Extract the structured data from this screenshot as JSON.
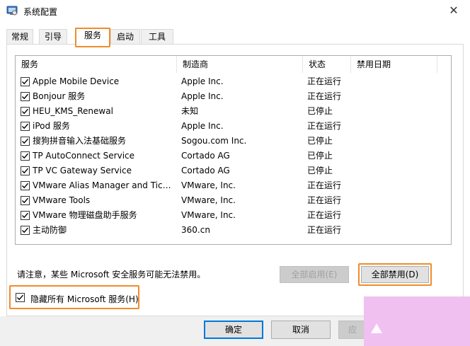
{
  "window": {
    "title": "系统配置",
    "close_glyph": "✕"
  },
  "tabs": [
    {
      "label": "常规"
    },
    {
      "label": "引导"
    },
    {
      "label": "服务"
    },
    {
      "label": "启动"
    },
    {
      "label": "工具"
    }
  ],
  "active_tab": "服务",
  "table": {
    "columns": [
      "服务",
      "制造商",
      "状态",
      "禁用日期"
    ],
    "rows": [
      {
        "service": "Apple Mobile Device",
        "maker": "Apple Inc.",
        "status": "正在运行",
        "date": "",
        "checked": true
      },
      {
        "service": "Bonjour 服务",
        "maker": "Apple Inc.",
        "status": "正在运行",
        "date": "",
        "checked": true
      },
      {
        "service": "HEU_KMS_Renewal",
        "maker": "未知",
        "status": "已停止",
        "date": "",
        "checked": true
      },
      {
        "service": "iPod 服务",
        "maker": "Apple Inc.",
        "status": "正在运行",
        "date": "",
        "checked": true
      },
      {
        "service": "搜狗拼音输入法基础服务",
        "maker": "Sogou.com Inc.",
        "status": "已停止",
        "date": "",
        "checked": true
      },
      {
        "service": "TP AutoConnect Service",
        "maker": "Cortado AG",
        "status": "已停止",
        "date": "",
        "checked": true
      },
      {
        "service": "TP VC Gateway Service",
        "maker": "Cortado AG",
        "status": "已停止",
        "date": "",
        "checked": true
      },
      {
        "service": "VMware Alias Manager and Tick…",
        "maker": "VMware, Inc.",
        "status": "正在运行",
        "date": "",
        "checked": true
      },
      {
        "service": "VMware Tools",
        "maker": "VMware, Inc.",
        "status": "正在运行",
        "date": "",
        "checked": true
      },
      {
        "service": "VMware 物理磁盘助手服务",
        "maker": "VMware, Inc.",
        "status": "正在运行",
        "date": "",
        "checked": true
      },
      {
        "service": "主动防御",
        "maker": "360.cn",
        "status": "正在运行",
        "date": "",
        "checked": true
      }
    ]
  },
  "notice": "请注意，某些 Microsoft 安全服务可能无法禁用。",
  "buttons": {
    "enable_all": "全部启用(E)",
    "disable_all": "全部禁用(D)",
    "ok": "确定",
    "cancel": "取消",
    "apply_partial": "应"
  },
  "hide_ms": {
    "label": "隐藏所有 Microsoft 服务(H)",
    "checked": true
  },
  "colors": {
    "highlight": "#f08c2a",
    "overlay": "#f0c0f0"
  }
}
